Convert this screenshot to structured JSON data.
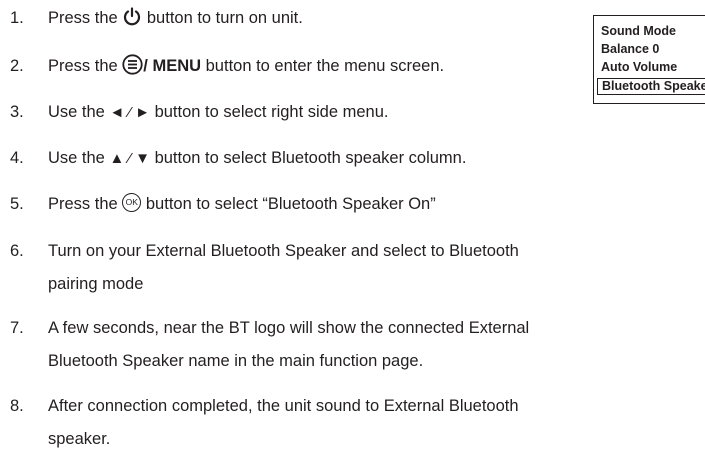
{
  "steps": [
    {
      "num": "1.",
      "a": "Press the ",
      "icon": "power-icon",
      "b": " button to turn on unit."
    },
    {
      "num": "2.",
      "a": "Press the ",
      "icon": "menu-icon",
      "bold": "/ MENU",
      "b": " button to enter the menu screen."
    },
    {
      "num": "3.",
      "a": "Use the ",
      "icon": "left-right-arrows-icon",
      "glyph": "◄ ⁄ ►",
      "b": " button to select right side menu."
    },
    {
      "num": "4.",
      "a": "Use the ",
      "icon": "up-down-arrows-icon",
      "glyph": "▲ ⁄ ▼",
      "b": " button to select Bluetooth speaker column."
    },
    {
      "num": "5.",
      "a": "Press the ",
      "icon": "ok-button-icon",
      "glyph": "OK",
      "b": " button to select “Bluetooth Speaker On”"
    },
    {
      "num": "6.",
      "a": "Turn on your External Bluetooth Speaker and select to Bluetooth",
      "b": "pairing mode"
    },
    {
      "num": "7.",
      "a": "A few seconds, near the BT logo will show the connected External",
      "b": "Bluetooth Speaker name in the main function page."
    },
    {
      "num": "8.",
      "a": "After connection completed, the unit sound to External Bluetooth",
      "b": "speaker."
    }
  ],
  "menu": {
    "items": [
      "Sound Mode",
      "Balance 0",
      "Auto Volume",
      "Bluetooth Speaker"
    ],
    "selected_index": 3
  }
}
